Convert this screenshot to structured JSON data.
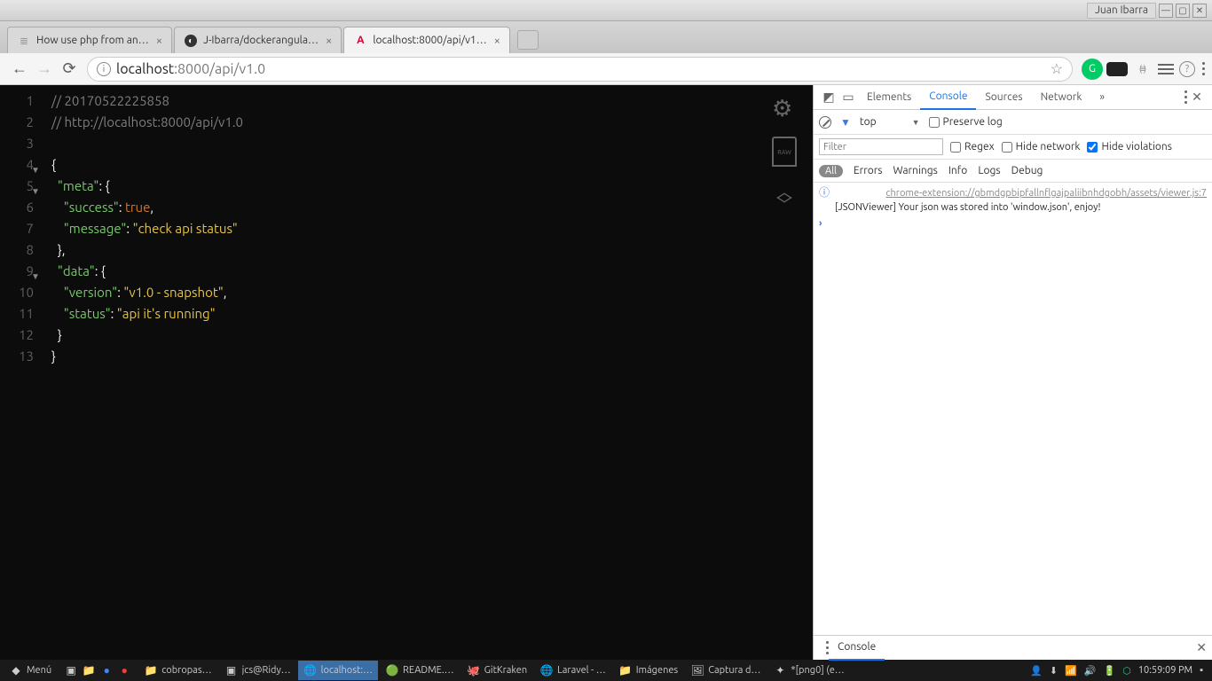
{
  "os": {
    "window_name": "Juan Ibarra"
  },
  "browser": {
    "tabs": [
      {
        "title": "How use php from an…",
        "favicon": "stack"
      },
      {
        "title": "J-Ibarra/dockerangula…",
        "favicon": "github"
      },
      {
        "title": "localhost:8000/api/v1…",
        "favicon": "angular",
        "active": true
      }
    ],
    "url": {
      "host": "localhost",
      "port": ":8000",
      "path": "/api/v1.0"
    }
  },
  "code": {
    "lines": [
      {
        "n": 1,
        "html": "<span class='cm'>// 20170522225858</span>"
      },
      {
        "n": 2,
        "html": "<span class='cm'>// http://localhost:8000/api/v1.0</span>"
      },
      {
        "n": 3,
        "html": ""
      },
      {
        "n": 4,
        "fold": true,
        "html": "<span class='br'>{</span>"
      },
      {
        "n": 5,
        "fold": true,
        "html": "  <span class='ky'>\"meta\"</span><span class='pu'>: </span><span class='br'>{</span>"
      },
      {
        "n": 6,
        "html": "    <span class='ky'>\"success\"</span><span class='pu'>: </span><span class='bo'>true</span><span class='pu'>,</span>"
      },
      {
        "n": 7,
        "html": "    <span class='ky'>\"message\"</span><span class='pu'>: </span><span class='st'>\"check api status\"</span>"
      },
      {
        "n": 8,
        "html": "  <span class='br'>}</span><span class='pu'>,</span>"
      },
      {
        "n": 9,
        "fold": true,
        "html": "  <span class='ky'>\"data\"</span><span class='pu'>: </span><span class='br'>{</span>"
      },
      {
        "n": 10,
        "html": "    <span class='ky'>\"version\"</span><span class='pu'>: </span><span class='st'>\"v1.0 - snapshot\"</span><span class='pu'>,</span>"
      },
      {
        "n": 11,
        "html": "    <span class='ky'>\"status\"</span><span class='pu'>: </span><span class='st'>\"api it's running\"</span>"
      },
      {
        "n": 12,
        "html": "  <span class='br'>}</span>"
      },
      {
        "n": 13,
        "html": "<span class='br'>}</span>"
      }
    ],
    "raw_label": "RAW"
  },
  "devtools": {
    "tabs": [
      "Elements",
      "Console",
      "Sources",
      "Network"
    ],
    "active_tab": "Console",
    "more": "»",
    "context": "top",
    "preserve_label": "Preserve log",
    "filter_placeholder": "Filter",
    "regex_label": "Regex",
    "hidenet_label": "Hide network",
    "hideviol_label": "Hide violations",
    "levels": {
      "all": "All",
      "errors": "Errors",
      "warnings": "Warnings",
      "info": "Info",
      "logs": "Logs",
      "debug": "Debug"
    },
    "log_source": "chrome-extension://gbmdgpbipfallnflgajpaliibnhdgobh/assets/viewer.js:7",
    "log_text": "[JSONViewer] Your json was stored into 'window.json', enjoy!",
    "drawer_tab": "Console"
  },
  "taskbar": {
    "menu": "Menú",
    "items": [
      {
        "label": "cobropas…",
        "icon": "📁"
      },
      {
        "label": "jcs@Ridy…",
        "icon": "▣"
      },
      {
        "label": "localhost:…",
        "icon": "🌐",
        "active": true
      },
      {
        "label": "README.…",
        "icon": "🟢"
      },
      {
        "label": "GitKraken",
        "icon": "🐙"
      },
      {
        "label": "Laravel - …",
        "icon": "🌐"
      },
      {
        "label": "Imágenes",
        "icon": "📁"
      },
      {
        "label": "Captura d…",
        "icon": "🖼"
      },
      {
        "label": "*[png0] (e…",
        "icon": "✦"
      }
    ],
    "clock": "10:59:09 PM"
  }
}
